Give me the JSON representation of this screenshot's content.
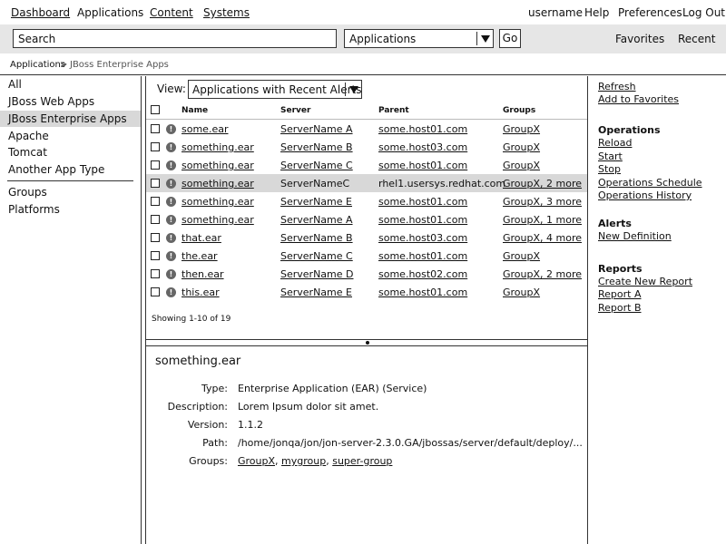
{
  "topnav": {
    "left": [
      "Dashboard",
      "Applications",
      "Content",
      "Systems"
    ],
    "right": [
      "username",
      "Help",
      "Preferences",
      "Log Out"
    ]
  },
  "search": {
    "placeholder": "Search",
    "scope": "Applications",
    "go": "Go",
    "favorites": "Favorites",
    "recent": "Recent"
  },
  "breadcrumb": {
    "root": "Applications",
    "sep": ">",
    "current": "JBoss Enterprise Apps"
  },
  "sidebar": {
    "items": [
      "All",
      "JBoss Web Apps",
      "JBoss Enterprise Apps",
      "Apache",
      "Tomcat",
      "Another App Type"
    ],
    "selected_index": 2,
    "items2": [
      "Groups",
      "Platforms"
    ]
  },
  "view": {
    "label": "View:",
    "selected": "Applications with Recent Alerts"
  },
  "table": {
    "headers": [
      "Name",
      "Server",
      "Parent",
      "Groups"
    ],
    "rows": [
      {
        "name": "some.ear",
        "server": "ServerName A",
        "parent": "some.host01.com",
        "groups": "GroupX"
      },
      {
        "name": "something.ear",
        "server": "ServerName B",
        "parent": "some.host03.com",
        "groups": "GroupX"
      },
      {
        "name": "something.ear",
        "server": "ServerName C",
        "parent": "some.host01.com",
        "groups": "GroupX"
      },
      {
        "name": "something.ear",
        "server": "ServerNameC",
        "parent": "rhel1.usersys.redhat.com",
        "groups": "GroupX, 2 more"
      },
      {
        "name": "something.ear",
        "server": "ServerName E",
        "parent": "some.host01.com",
        "groups": "GroupX, 3 more"
      },
      {
        "name": "something.ear",
        "server": "ServerName A",
        "parent": "some.host01.com",
        "groups": "GroupX, 1 more"
      },
      {
        "name": "that.ear",
        "server": "ServerName B",
        "parent": "some.host03.com",
        "groups": "GroupX, 4 more"
      },
      {
        "name": "the.ear",
        "server": "ServerName C",
        "parent": "some.host01.com",
        "groups": "GroupX"
      },
      {
        "name": "then.ear",
        "server": "ServerName D",
        "parent": "some.host02.com",
        "groups": "GroupX, 2 more"
      },
      {
        "name": "this.ear",
        "server": "ServerName E",
        "parent": "some.host01.com",
        "groups": "GroupX"
      }
    ],
    "selected_row": 3,
    "alert_glyph": "!",
    "showing": "Showing 1-10 of 19"
  },
  "detail": {
    "title": "something.ear",
    "type_label": "Type:",
    "type_value": "Enterprise Application (EAR) (Service)",
    "description_label": "Description:",
    "description_value": "Lorem Ipsum dolor sit amet.",
    "version_label": "Version:",
    "version_value": "1.1.2",
    "path_label": "Path:",
    "path_value": "/home/jonqa/jon/jon-server-2.3.0.GA/jbossas/server/default/deploy/...",
    "groups_label": "Groups:",
    "groups": [
      "GroupX",
      "mygroup",
      "super-group"
    ]
  },
  "actions": {
    "refresh": "Refresh",
    "add_to_favorites": "Add to Favorites",
    "operations_heading": "Operations",
    "operations": [
      "Reload",
      "Start",
      "Stop",
      "Operations Schedule",
      "Operations History"
    ],
    "alerts_heading": "Alerts",
    "alerts": [
      "New Definition"
    ],
    "reports_heading": "Reports",
    "reports": [
      "Create New Report",
      "Report A",
      "Report B"
    ]
  }
}
